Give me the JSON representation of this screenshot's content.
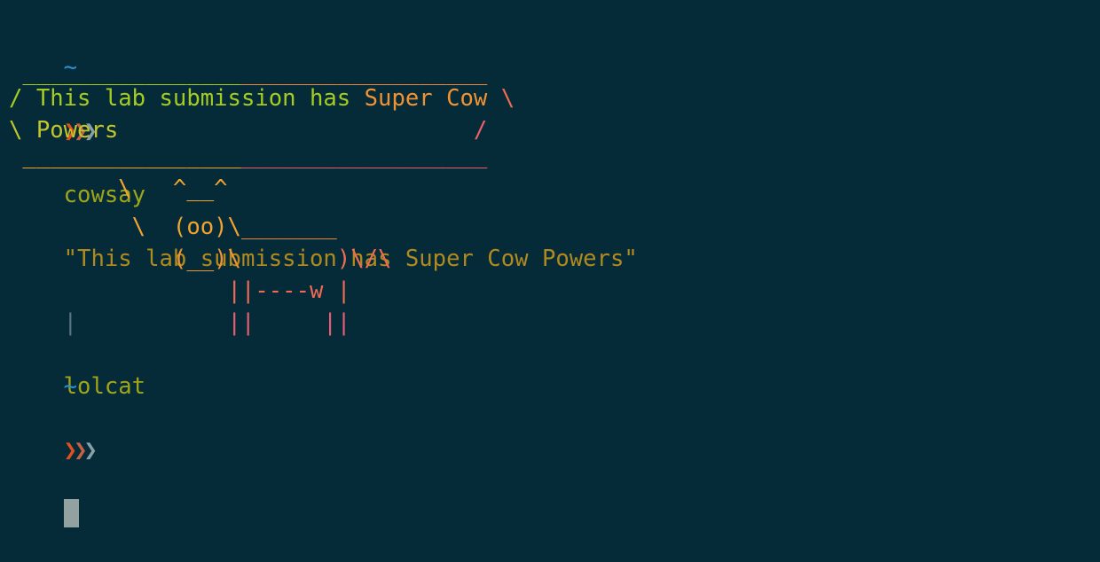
{
  "terminal": {
    "prompt_home": "~",
    "prompt_chevrons": "❯❯❯",
    "command": "cowsay",
    "command_arg": "\"This lab submission has Super Cow Powers\"",
    "pipe": "|",
    "pipe_cmd": "lolcat"
  },
  "output": {
    "bubble_top_a": " ________________",
    "bubble_top_b": "__________________",
    "bubble_l1_a": "/ This lab submission has ",
    "bubble_l1_b": "Super Cow ",
    "bubble_l1_c": "\\",
    "bubble_l2_a": "\\ Powers",
    "bubble_l2_b": "                          ",
    "bubble_l2_c": "/",
    "bubble_bot_a": " ________________",
    "bubble_bot_b": "__________________",
    "cow_1_a": "        \\   ",
    "cow_1_b": "^__^",
    "cow_2_a": "         \\  ",
    "cow_2_b": "(oo)\\",
    "cow_2_c": "_______",
    "cow_3_a": "            ",
    "cow_3_b": "(__)\\",
    "cow_3_c": "       )\\/\\",
    "cow_4_a": "                ",
    "cow_4_b": "||----w |",
    "cow_5_a": "                ",
    "cow_5_b": "||     ||"
  }
}
